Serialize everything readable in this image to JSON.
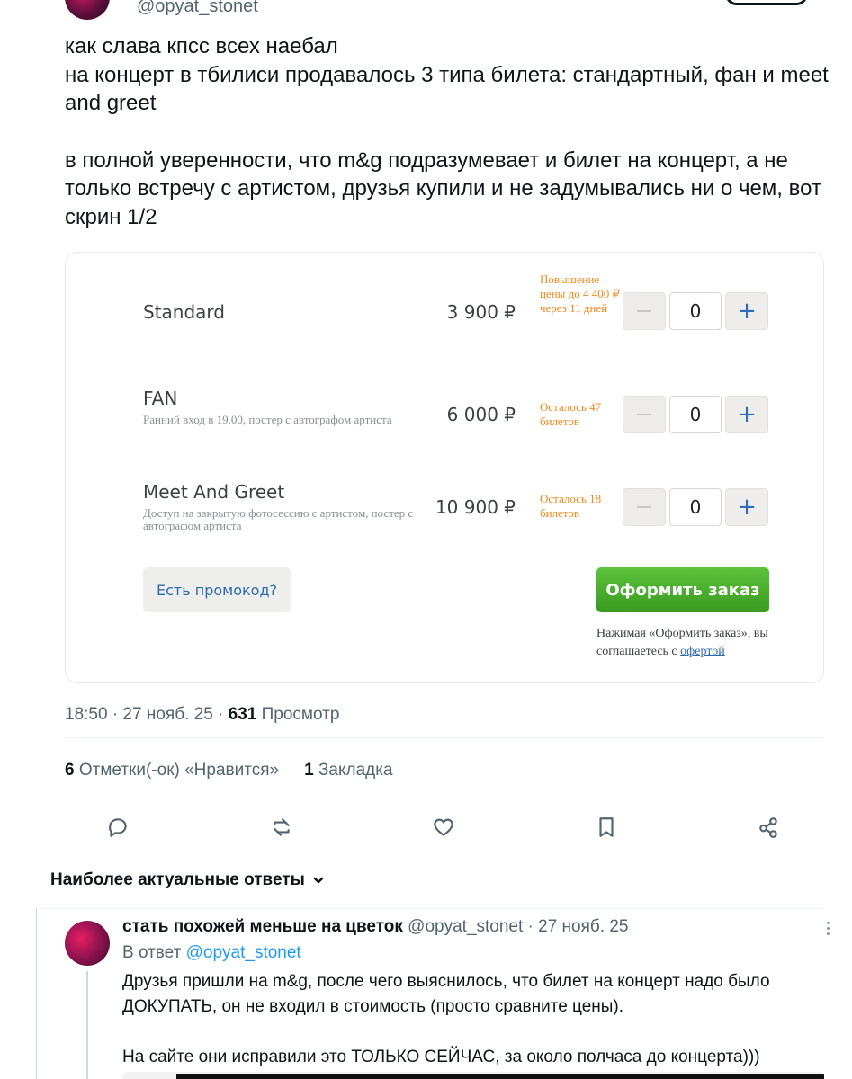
{
  "top": {
    "handle": "@opyat_stonet"
  },
  "tweet": {
    "line1": "как слава кпсс всех наебал",
    "line2": "на концерт в тбилиси продавалось 3 типа билета: стандартный, фан и meet and greet",
    "line3": "в полной уверенности, что m&g подразумевает и билет на концерт, а не только встречу с артистом, друзья купили и не задумывались ни о чем, вот скрин 1/2"
  },
  "tickets": [
    {
      "name": "Standard",
      "desc": "",
      "price": "3 900 ₽",
      "note": "Повышение цены до 4 400 ₽ через 11 дней",
      "qty": "0"
    },
    {
      "name": "FAN",
      "desc": "Ранний вход в 19.00, постер с автографом артиста",
      "price": "6 000 ₽",
      "note": "Осталось 47 билетов",
      "qty": "0"
    },
    {
      "name": "Meet And Greet",
      "desc": "Доступ на закрытую фотосессию с артистом, постер с автографом артиста",
      "price": "10 900 ₽",
      "note": "Осталось 18 билетов",
      "qty": "0"
    }
  ],
  "card": {
    "promo_label": "Есть промокод?",
    "order_label": "Оформить заказ",
    "agree_text": "Нажимая «Оформить заказ», вы соглашаетесь с",
    "offer_link": "офертой"
  },
  "meta": {
    "time": "18:50 · 27 нояб. 25 ·",
    "views_count": "631",
    "views_label": "Просмотр"
  },
  "stats": {
    "likes_count": "6",
    "likes_label": "Отметки(-ок) «Нравится»",
    "bookmarks_count": "1",
    "bookmarks_label": "Закладка"
  },
  "icons": {
    "reply": "reply-icon",
    "retweet": "retweet-icon",
    "like": "heart-icon",
    "bookmark": "bookmark-icon",
    "share": "share-icon"
  },
  "replies_header": {
    "label": "Наиболее актуальные ответы"
  },
  "reply": {
    "name": "стать похожей меньше на цветок",
    "handle_date": "@opyat_stonet · 27 нояб. 25",
    "replying_to_label": "В ответ",
    "replying_to_handle": "@opyat_stonet",
    "text1": "Друзья пришли на m&g, после чего выяснилось, что билет на концерт надо было ДОКУПАТЬ, он не входил в стоимость (просто сравните цены).",
    "text2": "На сайте они исправили это ТОЛЬКО СЕЙЧАС, за около полчаса до концерта)))"
  },
  "colors": {
    "accent": "#1d9bf0",
    "order_green": "#4cae2c",
    "note_orange": "#f08a1c",
    "link_blue": "#2e6aad"
  }
}
